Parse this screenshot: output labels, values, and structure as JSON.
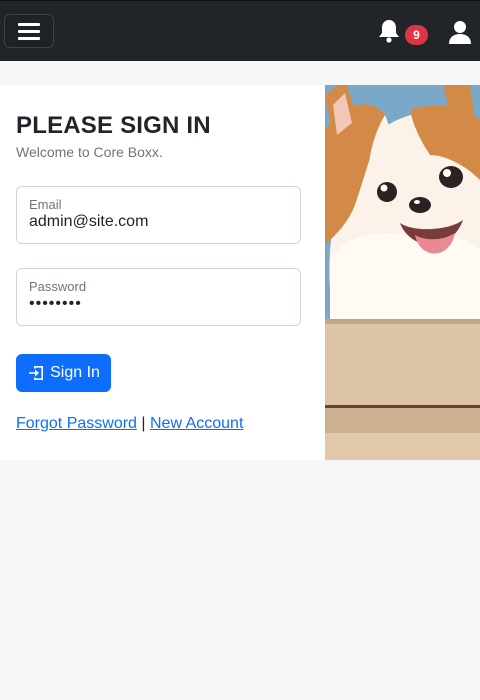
{
  "navbar": {
    "notification_count": "9"
  },
  "login": {
    "title": "PLEASE SIGN IN",
    "subtitle": "Welcome to Core Boxx.",
    "email_label": "Email",
    "email_value": "admin@site.com",
    "password_label": "Password",
    "password_value": "••••••••",
    "signin_label": "Sign In",
    "forgot_label": "Forgot Password",
    "separator": "|",
    "new_account_label": "New Account"
  },
  "icons": {
    "menu": "hamburger-menu-icon",
    "bell": "bell-icon",
    "user": "user-icon",
    "signin": "sign-in-icon"
  },
  "colors": {
    "navbar_bg": "#212529",
    "primary": "#0d6efd",
    "badge": "#dc3545",
    "page_bg": "#f6f7f9"
  }
}
